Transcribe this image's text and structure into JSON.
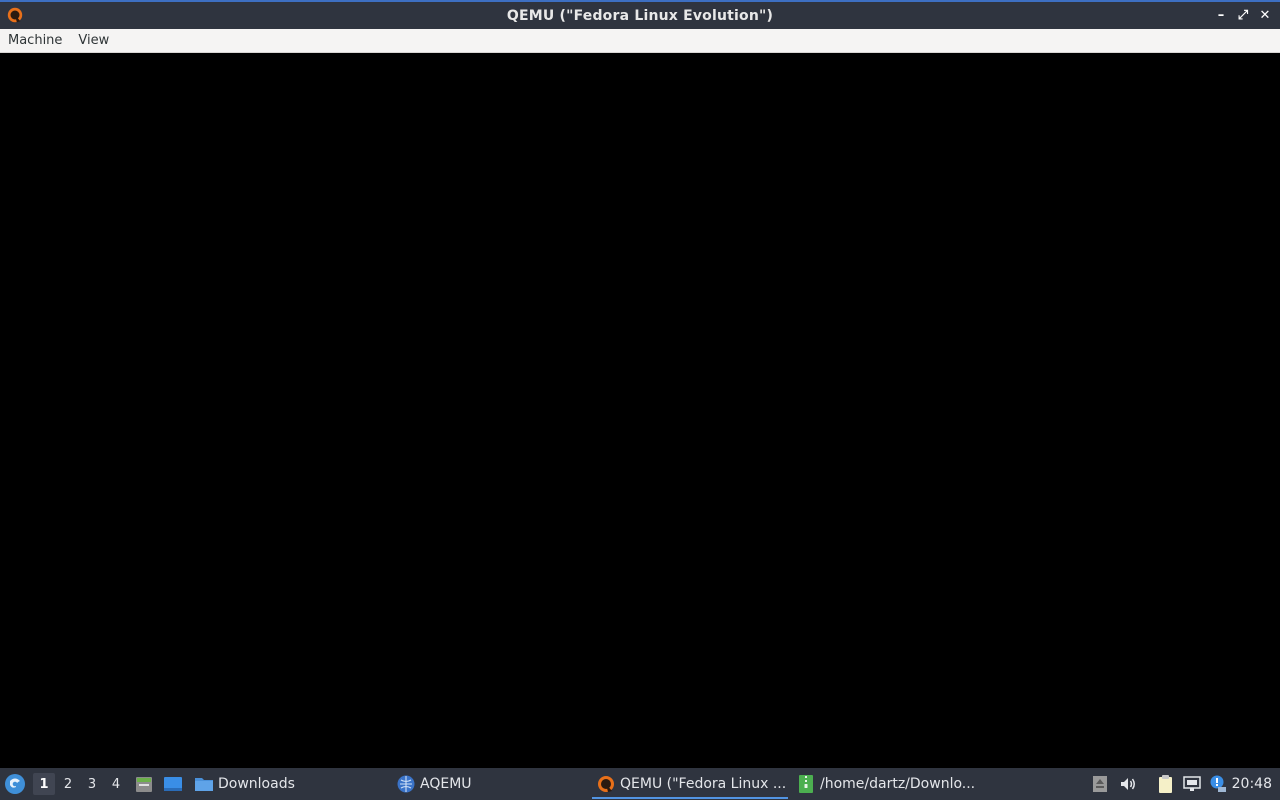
{
  "window": {
    "title": "QEMU (\"Fedora Linux Evolution\")",
    "buttons": {
      "minimize": "–",
      "maximize": "⤢",
      "close": "✕"
    }
  },
  "menubar": {
    "items": [
      "Machine",
      "View"
    ]
  },
  "taskbar": {
    "desktops": [
      "1",
      "2",
      "3",
      "4"
    ],
    "active_desktop": "1",
    "tasks": [
      {
        "label": "Downloads",
        "icon": "folder-icon"
      },
      {
        "label": "AQEMU",
        "icon": "aqemu-icon"
      },
      {
        "label": "QEMU (\"Fedora Linux ...",
        "icon": "qemu-icon",
        "active": true
      },
      {
        "label": "/home/dartz/Downlo...",
        "icon": "archive-icon"
      }
    ],
    "clock": "20:48"
  },
  "colors": {
    "titlebar": "#2f343f",
    "accent": "#5294e2",
    "display": "#000000"
  }
}
